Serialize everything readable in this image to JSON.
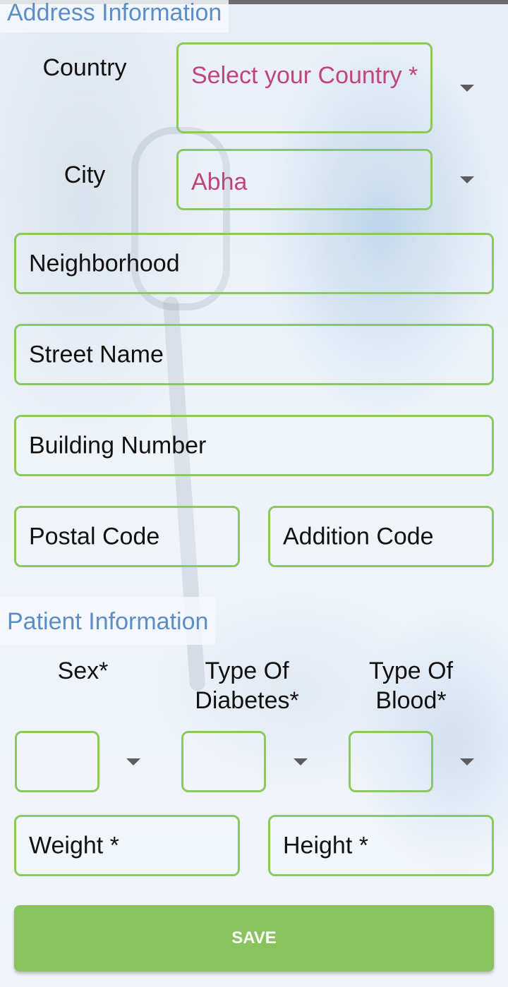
{
  "address": {
    "title": "Address Information",
    "country_label": "Country",
    "country_select": "Select your Country *",
    "city_label": "City",
    "city_select": "Abha",
    "neighborhood_placeholder": "Neighborhood",
    "street_placeholder": "Street Name",
    "building_placeholder": "Building Number",
    "postal_placeholder": "Postal Code",
    "addition_placeholder": "Addition Code"
  },
  "patient": {
    "title": "Patient Information",
    "sex_label": "Sex*",
    "diabetes_label": "Type Of Diabetes*",
    "blood_label": "Type Of Blood*",
    "weight_placeholder": "Weight *",
    "height_placeholder": "Height *"
  },
  "save_label": "SAVE",
  "icons": {
    "dropdown": "chevron-down-icon"
  },
  "colors": {
    "accent_green": "#8bc860",
    "title_blue": "#5b8ec7",
    "select_pink": "#c0457a"
  }
}
